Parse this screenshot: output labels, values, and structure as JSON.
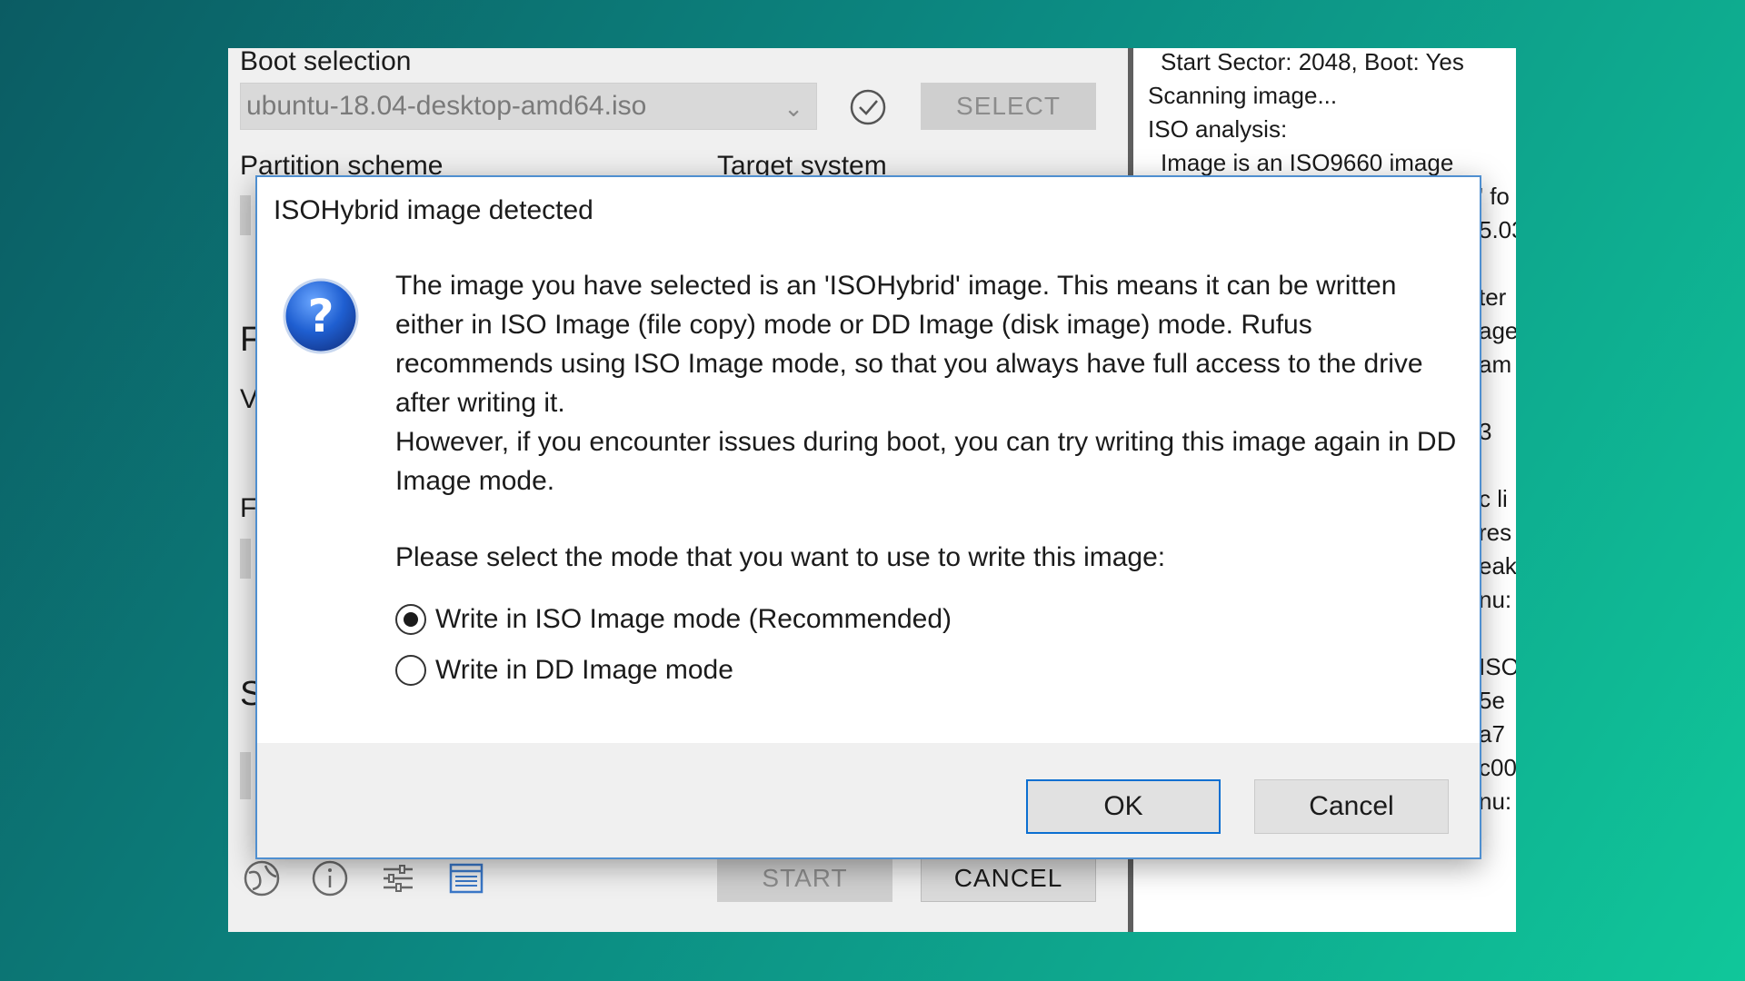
{
  "main_window": {
    "boot_selection_label": "Boot selection",
    "boot_selection_value": "ubuntu-18.04-desktop-amd64.iso",
    "select_button": "SELECT",
    "partition_scheme_label": "Partition scheme",
    "target_system_label": "Target system",
    "start_button": "START",
    "cancel_button": "CANCEL"
  },
  "log": {
    "lines": [
      "Start Sector: 2048, Boot: Yes",
      "Scanning image...",
      "ISO analysis:",
      "  Image is an ISO9660 image"
    ],
    "fragments": [
      "' fo",
      "5.03",
      "ter",
      "age",
      "am",
      "3",
      "c li",
      "res",
      "eak",
      "nu:",
      "ISO",
      "5e",
      "a7",
      "c00",
      "nu:"
    ]
  },
  "dialog": {
    "title": "ISOHybrid image detected",
    "icon": "question-icon",
    "message_1": "The image you have selected is an 'ISOHybrid' image. This means it can be written either in ISO Image (file copy) mode or DD Image (disk image) mode. Rufus recommends using ISO Image mode, so that you always have full access to the drive after writing it.",
    "message_2": "However, if you encounter issues during boot, you can try writing this image again in DD Image mode.",
    "prompt": "Please select the mode that you want to use to write this image:",
    "options": [
      {
        "label": "Write in ISO Image mode (Recommended)",
        "selected": true
      },
      {
        "label": "Write in DD Image mode",
        "selected": false
      }
    ],
    "ok_button": "OK",
    "cancel_button": "Cancel"
  },
  "colors": {
    "accent": "#0b6fd1",
    "dialog_border": "#4f8fd0"
  }
}
